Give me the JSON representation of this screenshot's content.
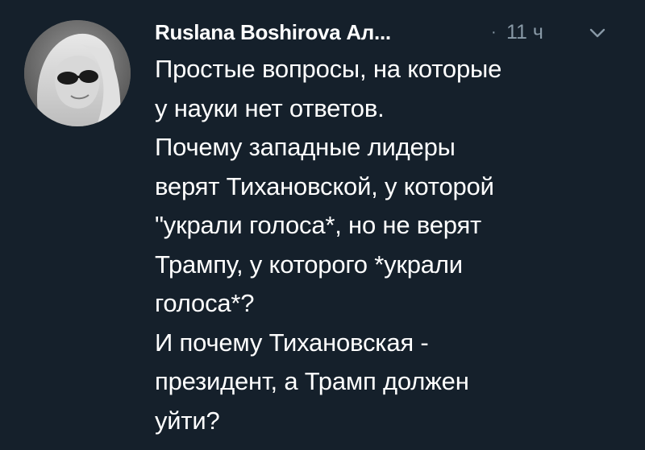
{
  "tweet": {
    "author_name": "Ruslana Boshirova Ал...",
    "separator": "·",
    "timestamp": "11 ч",
    "avatar_icon": "user-avatar-photo",
    "menu_icon": "chevron-down-icon",
    "lines": [
      "Простые вопросы, на которые",
      "у науки нет ответов.",
      "Почему западные лидеры",
      "верят Тихановской, у которой",
      "\"украли голоса*, но не верят",
      "Трампу, у которого *украли",
      "голоса*?",
      "И почему Тихановская -",
      "президент, а Трамп должен",
      "уйти?"
    ]
  },
  "colors": {
    "background": "#15202b",
    "text": "#ffffff",
    "secondary_text": "#8899a6"
  }
}
